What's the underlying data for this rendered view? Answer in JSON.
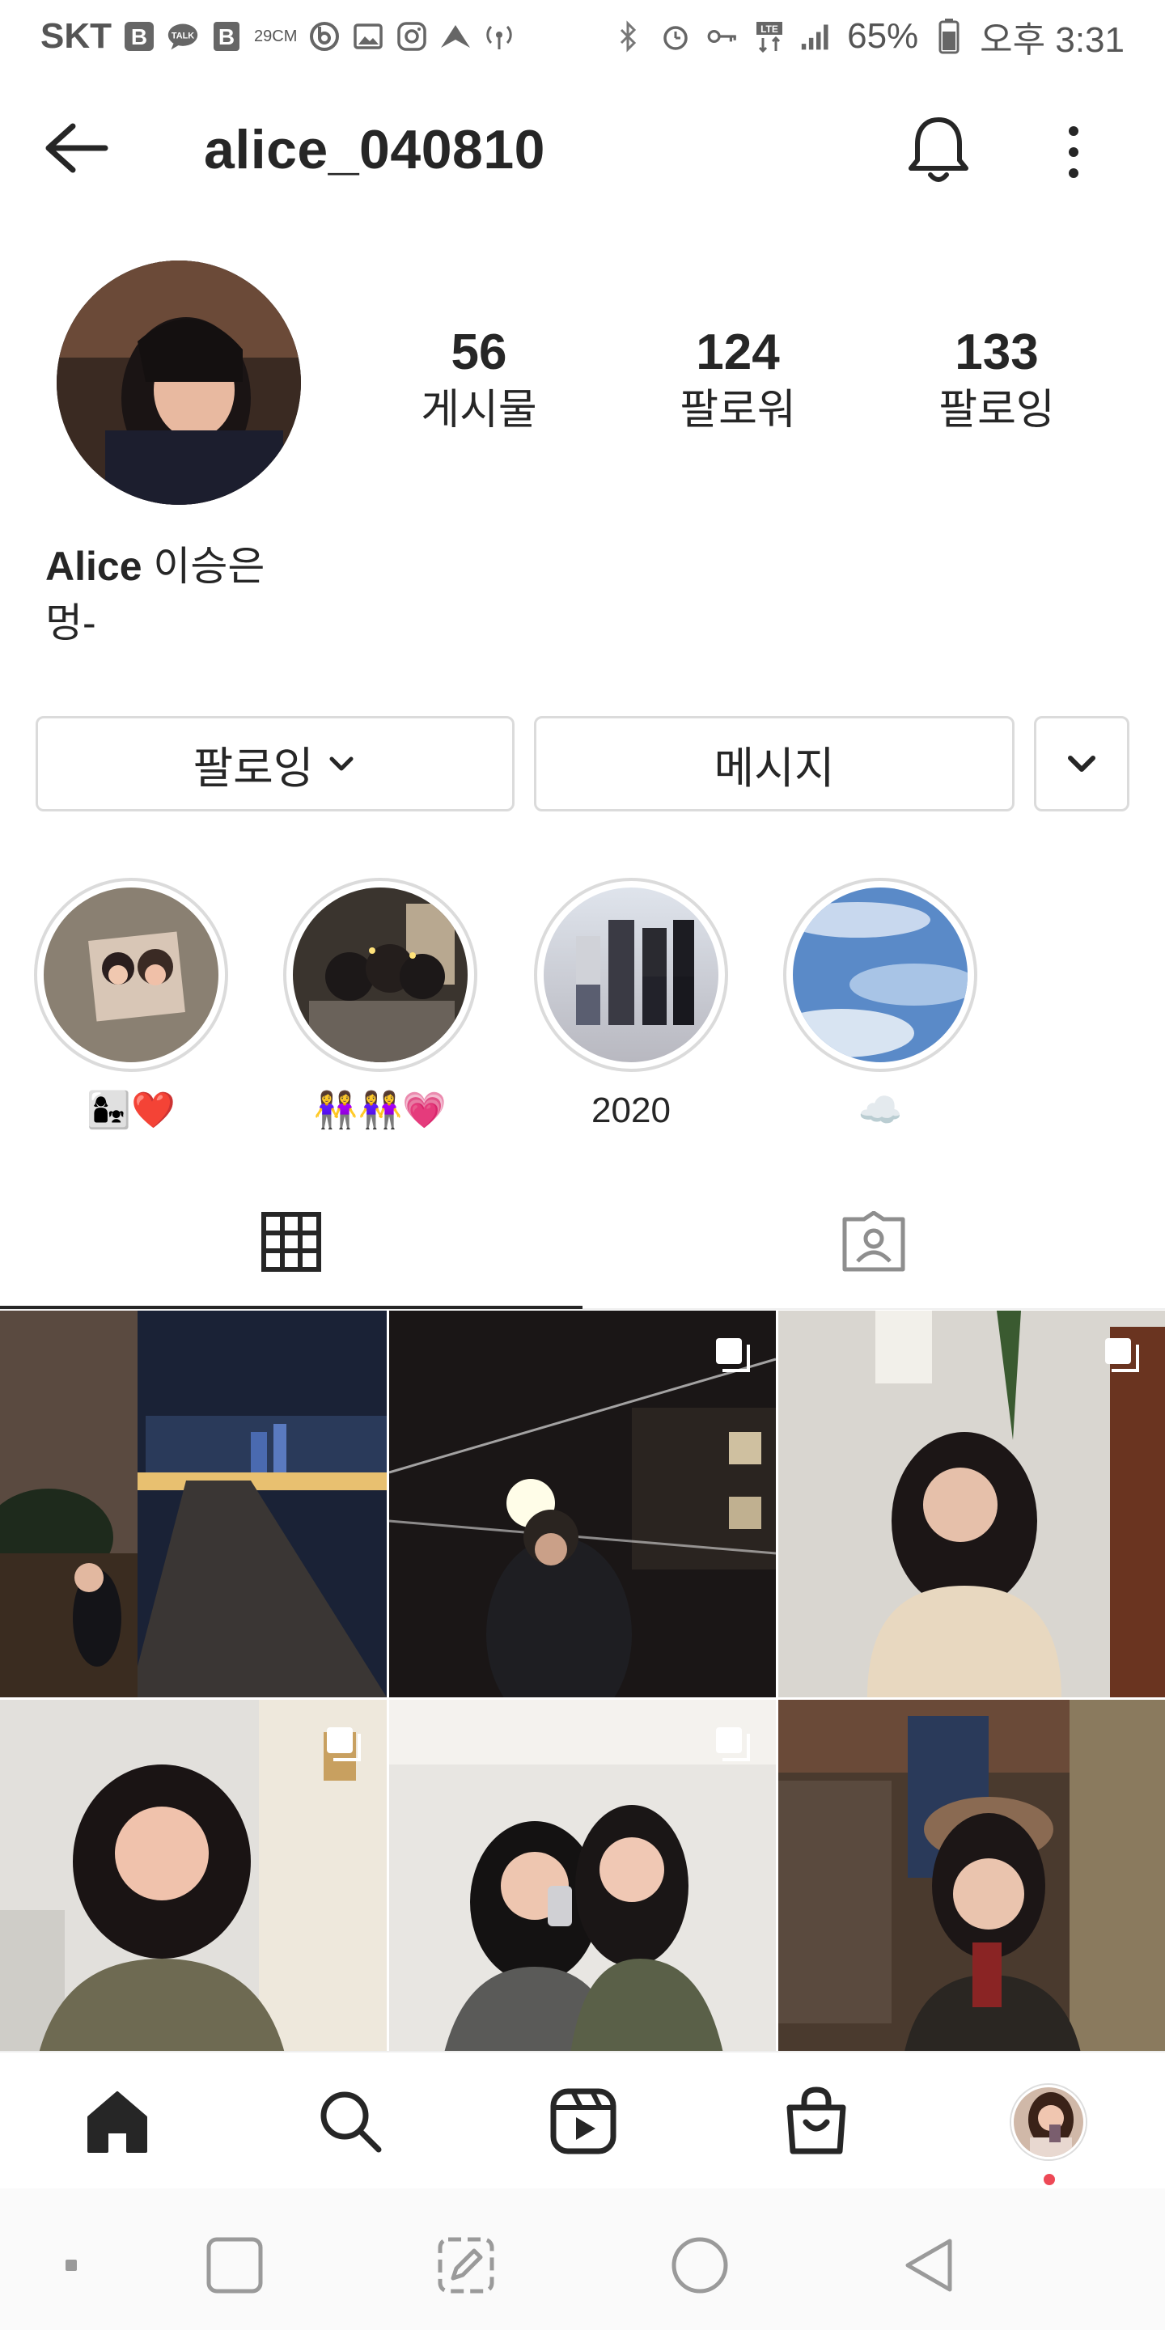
{
  "status_bar": {
    "carrier": "SKT",
    "temp": "29CM",
    "battery": "65%",
    "time": "오후 3:31"
  },
  "header": {
    "username": "alice_040810"
  },
  "profile": {
    "stats": [
      {
        "count": "56",
        "label": "게시물"
      },
      {
        "count": "124",
        "label": "팔로워"
      },
      {
        "count": "133",
        "label": "팔로잉"
      }
    ],
    "name_en": "Alice",
    "name_ko": "이승은",
    "bio": "멍-"
  },
  "buttons": {
    "following": "팔로잉",
    "message": "메시지"
  },
  "highlights": [
    {
      "label": "👩‍👧❤️"
    },
    {
      "label": "👭👭💗"
    },
    {
      "label": "2020"
    },
    {
      "label": "☁️"
    }
  ],
  "colors": {
    "text": "#262626",
    "border": "#dbdbdb",
    "notification_dot": "#ed4956"
  },
  "icons": {
    "tab_grid": "grid-icon",
    "tab_tagged": "tagged-icon",
    "nav": [
      "home-icon",
      "search-icon",
      "reels-icon",
      "shop-icon"
    ]
  }
}
